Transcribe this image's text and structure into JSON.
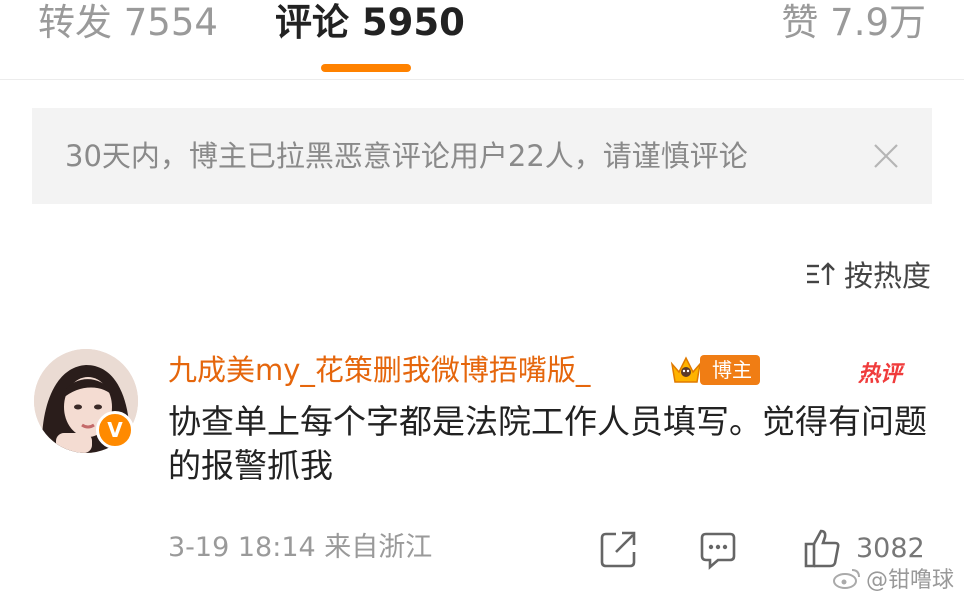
{
  "tabs": {
    "reposts": "转发 7554",
    "comments": "评论 5950",
    "likes": "赞 7.9万"
  },
  "notice": {
    "text": "30天内，博主已拉黑恶意评论用户22人，请谨慎评论"
  },
  "sort": {
    "label": "按热度"
  },
  "comment": {
    "username": "九成美my_花策删我微博捂嘴版_",
    "author_badge": "博主",
    "hot_badge": "热评",
    "text": "协查单上每个字都是法院工作人员填写。觉得有问题的报警抓我",
    "meta": "3-19 18:14 来自浙江",
    "like_count": "3082"
  },
  "watermark": {
    "text": "@钳噜球"
  },
  "colors": {
    "accent": "#ff8200",
    "username": "#e5660c",
    "hot": "#f03c3c"
  }
}
